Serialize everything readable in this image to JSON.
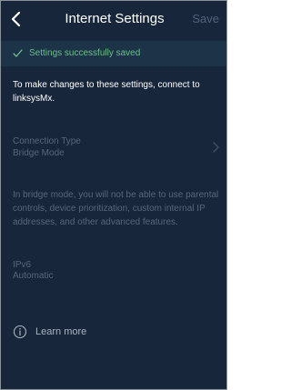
{
  "header": {
    "back_icon": "chevron-left-icon",
    "title": "Internet Settings",
    "save_label": "Save"
  },
  "banner": {
    "icon": "check-icon",
    "text": "Settings successfully saved",
    "color": "#6dbf8a"
  },
  "intro_text": "To make changes to these settings, connect to linksysMx.",
  "connection_type": {
    "label": "Connection Type",
    "value": "Bridge Mode",
    "icon": "chevron-right-icon"
  },
  "bridge_note": "In bridge mode, you will not be able to use parental controls, device prioritization, custom internal IP addresses, and other advanced features.",
  "ipv6": {
    "label": "IPv6",
    "value": "Automatic"
  },
  "learn_more": {
    "icon": "info-icon",
    "label": "Learn more"
  },
  "colors": {
    "background": "#17263a",
    "banner_background": "#1d3348",
    "disabled_text": "#56677c"
  }
}
